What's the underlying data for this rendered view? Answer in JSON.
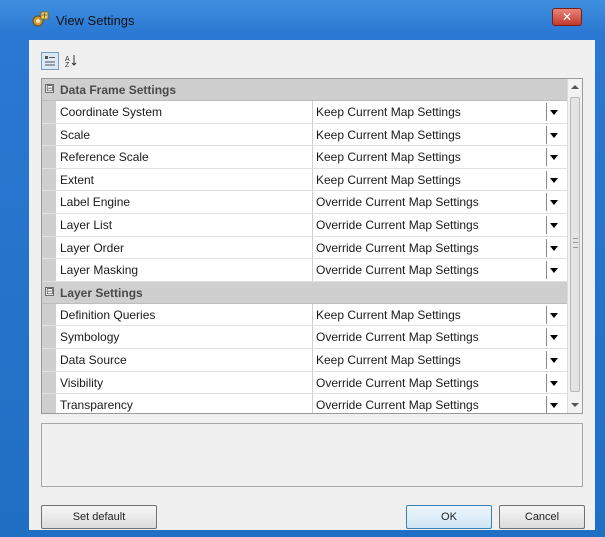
{
  "window": {
    "title": "View Settings",
    "close_label": "✕"
  },
  "toolbar": {
    "categorized_icon": "categorized-view-icon",
    "alphabetical_icon": "alphabetical-sort-icon"
  },
  "grid": {
    "categories": [
      {
        "label": "Data Frame Settings",
        "toggle": "⊟",
        "properties": [
          {
            "name": "Coordinate System",
            "value": "Keep Current Map Settings"
          },
          {
            "name": "Scale",
            "value": "Keep Current Map Settings"
          },
          {
            "name": "Reference Scale",
            "value": "Keep Current Map Settings"
          },
          {
            "name": "Extent",
            "value": "Keep Current Map Settings"
          },
          {
            "name": "Label Engine",
            "value": "Override Current Map Settings"
          },
          {
            "name": "Layer List",
            "value": "Override Current Map Settings"
          },
          {
            "name": "Layer Order",
            "value": "Override Current Map Settings"
          },
          {
            "name": "Layer Masking",
            "value": "Override Current Map Settings"
          }
        ]
      },
      {
        "label": "Layer Settings",
        "toggle": "⊟",
        "properties": [
          {
            "name": "Definition Queries",
            "value": "Keep Current Map Settings"
          },
          {
            "name": "Symbology",
            "value": "Override Current Map Settings"
          },
          {
            "name": "Data Source",
            "value": "Keep Current Map Settings"
          },
          {
            "name": "Visibility",
            "value": "Override Current Map Settings"
          },
          {
            "name": "Transparency",
            "value": "Override Current Map Settings"
          }
        ]
      }
    ]
  },
  "buttons": {
    "set_default": "Set default",
    "ok": "OK",
    "cancel": "Cancel"
  }
}
